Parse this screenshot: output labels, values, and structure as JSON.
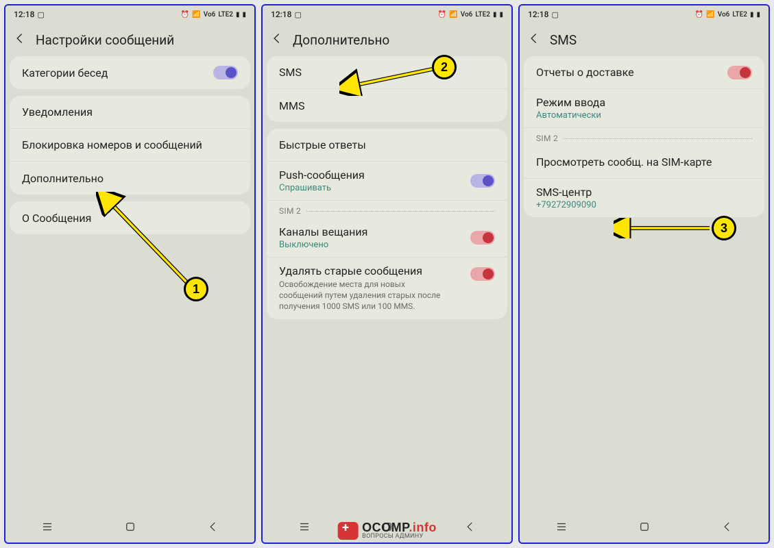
{
  "status": {
    "time": "12:18",
    "lte": "LTE2",
    "vo": "Vo6"
  },
  "screens": [
    {
      "title": "Настройки сообщений",
      "cards": [
        {
          "rows": [
            {
              "title": "Категории бесед",
              "toggle": "purple-on"
            }
          ]
        },
        {
          "rows": [
            {
              "title": "Уведомления"
            },
            {
              "title": "Блокировка номеров и сообщений"
            },
            {
              "title": "Дополнительно"
            }
          ]
        },
        {
          "rows": [
            {
              "title": "О Сообщения"
            }
          ]
        }
      ]
    },
    {
      "title": "Дополнительно",
      "cards": [
        {
          "rows": [
            {
              "title": "SMS"
            },
            {
              "title": "MMS"
            }
          ]
        },
        {
          "rows": [
            {
              "title": "Быстрые ответы"
            },
            {
              "title": "Push-сообщения",
              "sub": "Спрашивать",
              "toggle": "purple-on"
            }
          ],
          "sim": "SIM 2",
          "rows2": [
            {
              "title": "Каналы вещания",
              "sub": "Выключено",
              "toggle": "red-on"
            },
            {
              "title": "Удалять старые сообщения",
              "desc": "Освобождение места для новых сообщений путем удаления старых после получения 1000 SMS или 100 MMS.",
              "toggle": "red-on"
            }
          ]
        }
      ]
    },
    {
      "title": "SMS",
      "cards": [
        {
          "rows": [
            {
              "title": "Отчеты о доставке",
              "toggle": "red-on"
            },
            {
              "title": "Режим ввода",
              "sub": "Автоматически"
            }
          ],
          "sim": "SIM 2",
          "rows2": [
            {
              "title": "Просмотреть сообщ. на SIM-карте"
            },
            {
              "title": "SMS-центр",
              "sub": "+79272909090"
            }
          ]
        }
      ]
    }
  ],
  "watermark": {
    "main": "OCOMP",
    "suffix": ".info",
    "sub": "ВОПРОСЫ АДМИНУ"
  },
  "badges": {
    "b1": "1",
    "b2": "2",
    "b3": "3"
  }
}
